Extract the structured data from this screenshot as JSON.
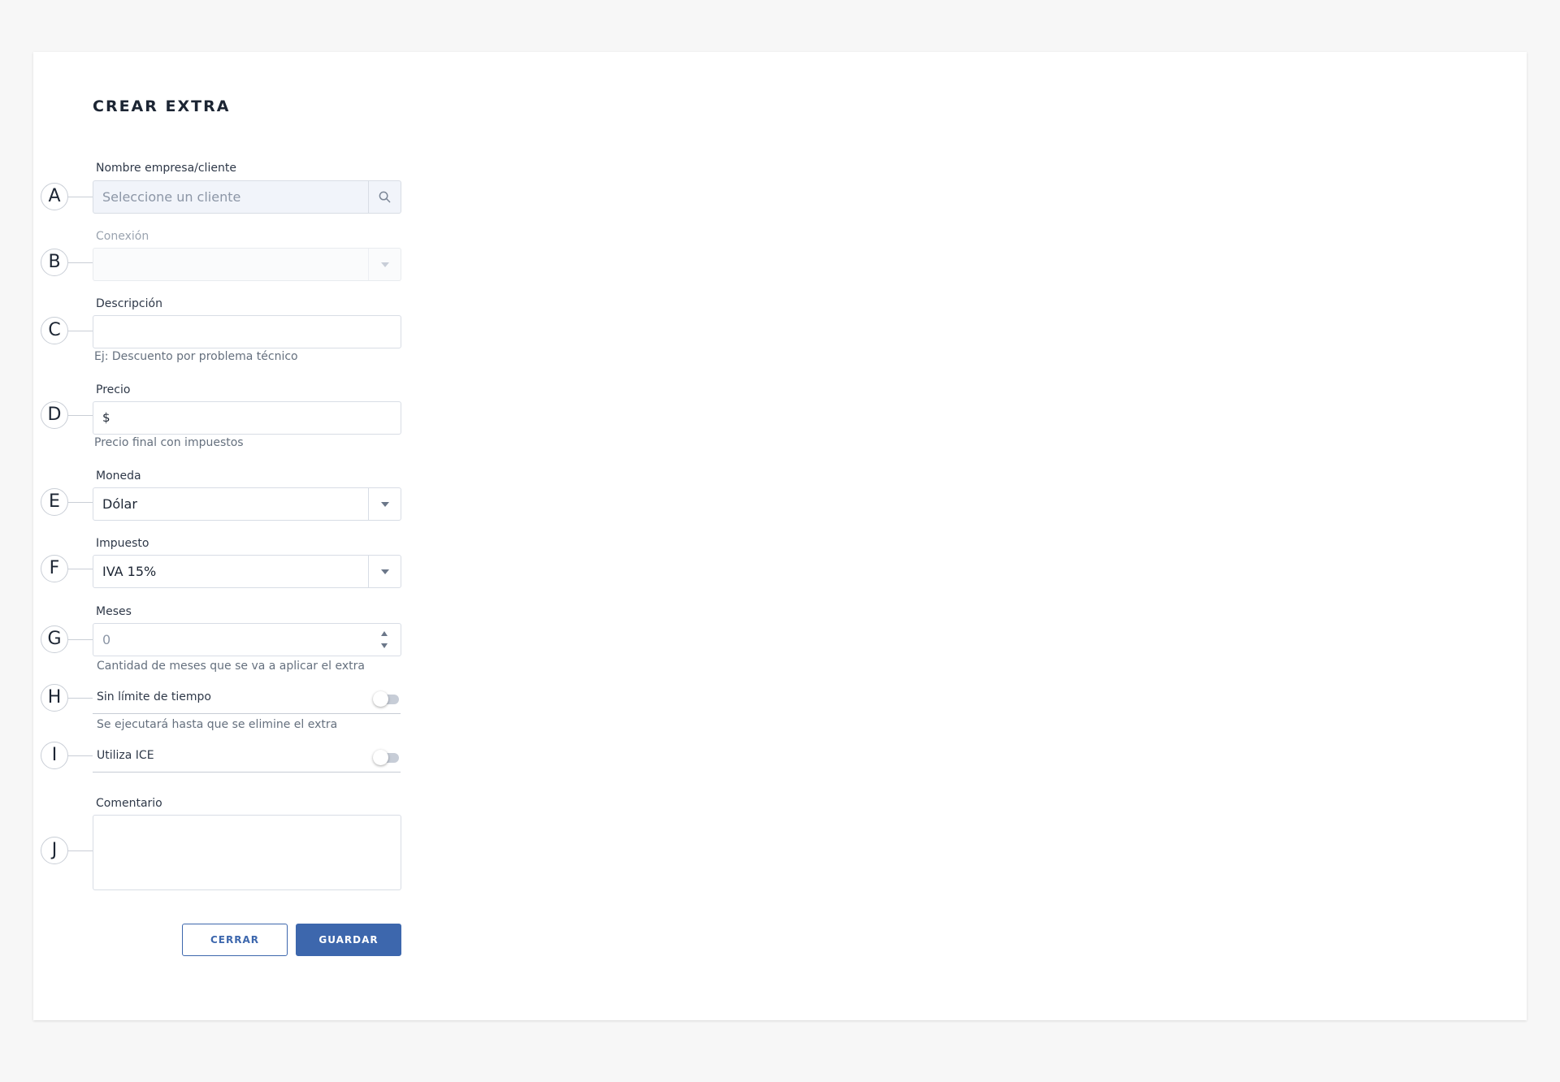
{
  "form": {
    "title": "CREAR EXTRA",
    "client": {
      "marker": "A",
      "label": "Nombre empresa/cliente",
      "placeholder": "Seleccione un cliente"
    },
    "connection": {
      "marker": "B",
      "label": "Conexión",
      "value": ""
    },
    "description": {
      "marker": "C",
      "label": "Descripción",
      "value": "",
      "hint": "Ej: Descuento por problema técnico"
    },
    "price": {
      "marker": "D",
      "label": "Precio",
      "prefix": "$",
      "value": "",
      "hint": "Precio final con impuestos"
    },
    "currency": {
      "marker": "E",
      "label": "Moneda",
      "value": "Dólar"
    },
    "tax": {
      "marker": "F",
      "label": "Impuesto",
      "value": "IVA 15%"
    },
    "months": {
      "marker": "G",
      "label": "Meses",
      "placeholder": "0",
      "hint": "Cantidad de meses que se va a aplicar el extra"
    },
    "no_limit": {
      "marker": "H",
      "label": "Sin límite de tiempo",
      "hint": "Se ejecutará hasta que se elimine el extra",
      "enabled": false
    },
    "uses_ice": {
      "marker": "I",
      "label": "Utiliza ICE",
      "enabled": false
    },
    "comment": {
      "marker": "J",
      "label": "Comentario",
      "value": ""
    },
    "buttons": {
      "close": "CERRAR",
      "save": "GUARDAR"
    }
  },
  "icons": {
    "search": "search-icon",
    "dropdown": "chevron-down-icon",
    "stepper": "stepper-arrows-icon"
  },
  "colors": {
    "primary": "#3d67ad",
    "background": "#f7f7f7",
    "card": "#ffffff"
  }
}
